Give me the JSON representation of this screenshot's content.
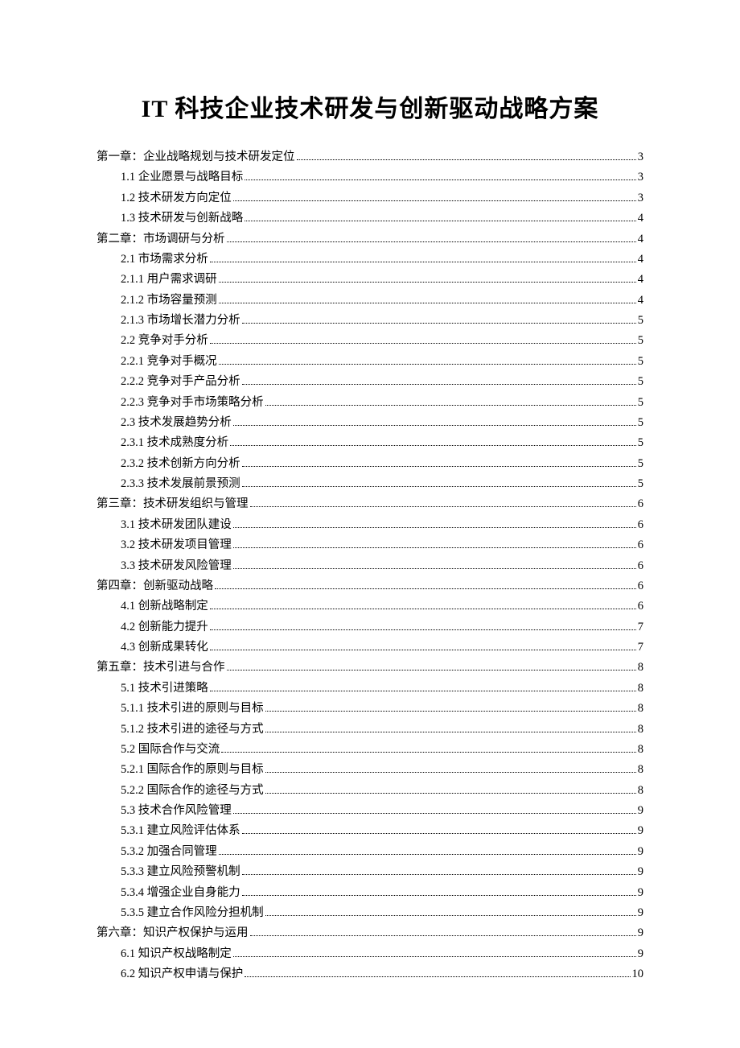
{
  "title": "IT 科技企业技术研发与创新驱动战略方案",
  "toc": [
    {
      "level": 1,
      "label": "第一章：企业战略规划与技术研发定位",
      "page": "3"
    },
    {
      "level": 2,
      "label": "1.1 企业愿景与战略目标",
      "page": "3"
    },
    {
      "level": 2,
      "label": "1.2 技术研发方向定位",
      "page": "3"
    },
    {
      "level": 2,
      "label": "1.3 技术研发与创新战略",
      "page": "4"
    },
    {
      "level": 1,
      "label": "第二章：市场调研与分析",
      "page": "4"
    },
    {
      "level": 2,
      "label": "2.1 市场需求分析",
      "page": "4"
    },
    {
      "level": 2,
      "label": "2.1.1 用户需求调研",
      "page": "4"
    },
    {
      "level": 2,
      "label": "2.1.2 市场容量预测",
      "page": "4"
    },
    {
      "level": 2,
      "label": "2.1.3 市场增长潜力分析",
      "page": "5"
    },
    {
      "level": 2,
      "label": "2.2 竞争对手分析",
      "page": "5"
    },
    {
      "level": 2,
      "label": "2.2.1 竞争对手概况",
      "page": "5"
    },
    {
      "level": 2,
      "label": "2.2.2 竞争对手产品分析",
      "page": "5"
    },
    {
      "level": 2,
      "label": "2.2.3 竞争对手市场策略分析",
      "page": "5"
    },
    {
      "level": 2,
      "label": "2.3 技术发展趋势分析",
      "page": "5"
    },
    {
      "level": 2,
      "label": "2.3.1 技术成熟度分析",
      "page": "5"
    },
    {
      "level": 2,
      "label": "2.3.2 技术创新方向分析",
      "page": "5"
    },
    {
      "level": 2,
      "label": "2.3.3 技术发展前景预测",
      "page": "5"
    },
    {
      "level": 1,
      "label": "第三章：技术研发组织与管理",
      "page": "6"
    },
    {
      "level": 2,
      "label": "3.1 技术研发团队建设",
      "page": "6"
    },
    {
      "level": 2,
      "label": "3.2 技术研发项目管理",
      "page": "6"
    },
    {
      "level": 2,
      "label": "3.3 技术研发风险管理",
      "page": "6"
    },
    {
      "level": 1,
      "label": "第四章：创新驱动战略",
      "page": "6"
    },
    {
      "level": 2,
      "label": "4.1 创新战略制定",
      "page": "6"
    },
    {
      "level": 2,
      "label": "4.2 创新能力提升",
      "page": "7"
    },
    {
      "level": 2,
      "label": "4.3 创新成果转化",
      "page": "7"
    },
    {
      "level": 1,
      "label": "第五章：技术引进与合作",
      "page": "8"
    },
    {
      "level": 2,
      "label": "5.1 技术引进策略",
      "page": "8"
    },
    {
      "level": 2,
      "label": "5.1.1 技术引进的原则与目标",
      "page": "8"
    },
    {
      "level": 2,
      "label": "5.1.2 技术引进的途径与方式",
      "page": "8"
    },
    {
      "level": 2,
      "label": "5.2 国际合作与交流",
      "page": "8"
    },
    {
      "level": 2,
      "label": "5.2.1 国际合作的原则与目标",
      "page": "8"
    },
    {
      "level": 2,
      "label": "5.2.2 国际合作的途径与方式",
      "page": "8"
    },
    {
      "level": 2,
      "label": "5.3 技术合作风险管理",
      "page": "9"
    },
    {
      "level": 2,
      "label": "5.3.1 建立风险评估体系",
      "page": "9"
    },
    {
      "level": 2,
      "label": "5.3.2 加强合同管理",
      "page": "9"
    },
    {
      "level": 2,
      "label": "5.3.3 建立风险预警机制",
      "page": "9"
    },
    {
      "level": 2,
      "label": "5.3.4 增强企业自身能力",
      "page": "9"
    },
    {
      "level": 2,
      "label": "5.3.5 建立合作风险分担机制",
      "page": "9"
    },
    {
      "level": 1,
      "label": "第六章：知识产权保护与运用",
      "page": "9"
    },
    {
      "level": 2,
      "label": "6.1 知识产权战略制定",
      "page": "9"
    },
    {
      "level": 2,
      "label": "6.2 知识产权申请与保护",
      "page": "10"
    }
  ]
}
